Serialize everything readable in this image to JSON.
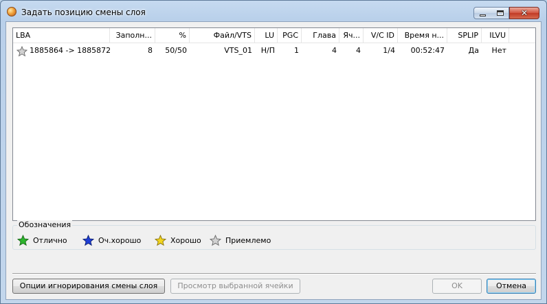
{
  "window": {
    "title": "Задать позицию смены слоя"
  },
  "columns": [
    {
      "key": "lba",
      "label": "LBA"
    },
    {
      "key": "fill",
      "label": "Заполн..."
    },
    {
      "key": "pct",
      "label": "%"
    },
    {
      "key": "file",
      "label": "Файл/VTS"
    },
    {
      "key": "lu",
      "label": "LU"
    },
    {
      "key": "pgc",
      "label": "PGC"
    },
    {
      "key": "chapter",
      "label": "Глава"
    },
    {
      "key": "cell",
      "label": "Яч..."
    },
    {
      "key": "vcid",
      "label": "V/C ID"
    },
    {
      "key": "time",
      "label": "Время н..."
    },
    {
      "key": "splip",
      "label": "SPLIP"
    },
    {
      "key": "ilvu",
      "label": "ILVU"
    }
  ],
  "rows": [
    {
      "rating": "grey-star-icon",
      "lba": "1885864 -> 1885872",
      "fill": "8",
      "pct": "50/50",
      "file": "VTS_01",
      "lu": "Н/П",
      "pgc": "1",
      "chapter": "4",
      "cell": "4",
      "vcid": "1/4",
      "time": "00:52:47",
      "splip": "Да",
      "ilvu": "Нет"
    }
  ],
  "legend": {
    "title": "Обозначения",
    "items": [
      {
        "icon": "green-star-icon",
        "color": "#2db52d",
        "label": "Отлично"
      },
      {
        "icon": "blue-star-icon",
        "color": "#1f3fd6",
        "label": "Оч.хорошо"
      },
      {
        "icon": "yellow-star-icon",
        "color": "#f2d51f",
        "label": "Хорошо"
      },
      {
        "icon": "grey-star-icon",
        "color": "#b9b9b9",
        "label": "Приемлемо"
      }
    ]
  },
  "buttons": {
    "ignore_options": "Опции игнорирования смены слоя",
    "view_cell": "Просмотр выбранной ячейки",
    "ok": "OK",
    "cancel": "Отмена"
  }
}
